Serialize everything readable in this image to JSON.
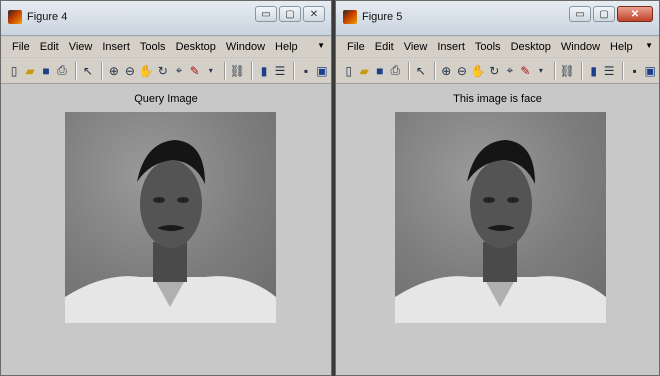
{
  "windows": [
    {
      "id": "figure4",
      "title": "Figure 4",
      "axes_title": "Query Image",
      "menu": [
        "File",
        "Edit",
        "View",
        "Insert",
        "Tools",
        "Desktop",
        "Window",
        "Help"
      ]
    },
    {
      "id": "figure5",
      "title": "Figure 5",
      "axes_title": "This image is face",
      "menu": [
        "File",
        "Edit",
        "View",
        "Insert",
        "Tools",
        "Desktop",
        "Window",
        "Help"
      ]
    }
  ],
  "toolbar_icons": [
    "new-figure-icon",
    "open-file-icon",
    "save-icon",
    "print-icon",
    "pointer-icon",
    "zoom-in-icon",
    "zoom-out-icon",
    "pan-icon",
    "rotate-icon",
    "data-cursor-icon",
    "brush-icon",
    "link-icon",
    "colorbar-icon",
    "legend-icon",
    "hide-plot-tools-icon",
    "show-plot-tools-icon"
  ],
  "window_buttons": {
    "minimize": "▭",
    "maximize": "▢",
    "close": "✕"
  }
}
